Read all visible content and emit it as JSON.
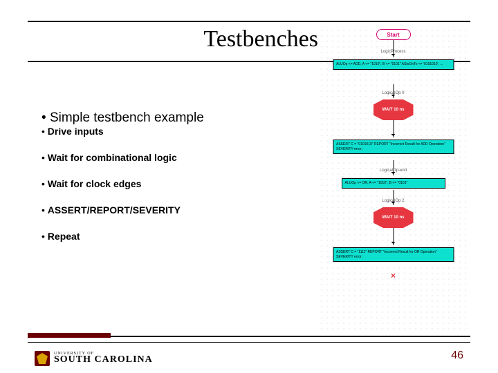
{
  "title": "Testbenches",
  "main_bullet": "Simple testbench example",
  "sub_bullets": [
    "Drive inputs",
    "Wait for combinational logic",
    "Wait for clock edges",
    "ASSERT/REPORT/SEVERITY",
    "Repeat"
  ],
  "flow": {
    "start": "Start",
    "edge_top": "LogicProcess",
    "proc1": "ALUOp <= ADD, A <= \"1010\",\nB <= \"0101\"\nAStoOnTo <= '0101010', ...",
    "edge1": "LogicalOp 0",
    "wait1": "WAIT 10 ns",
    "proc2": "ASSERT C = \"0101010\"\nREPORT \"Incorrect Result for ADD Operation\"\nSEVERITY error;",
    "edge2": "LogicalOp-end",
    "proc3": "ALUOp <= OR, A <= \"1010\", B <= \"0101\"",
    "edge3": "LogicalOp 2",
    "wait2": "WAIT 10 ns",
    "proc4": "ASSERT C = \"1111\"\nREPORT \"Incorrect Result for OR Operation\"\nSEVERITY error;"
  },
  "footer": {
    "uni": "UNIVERSITY OF",
    "sc": "SOUTH CAROLINA",
    "page": "46"
  }
}
